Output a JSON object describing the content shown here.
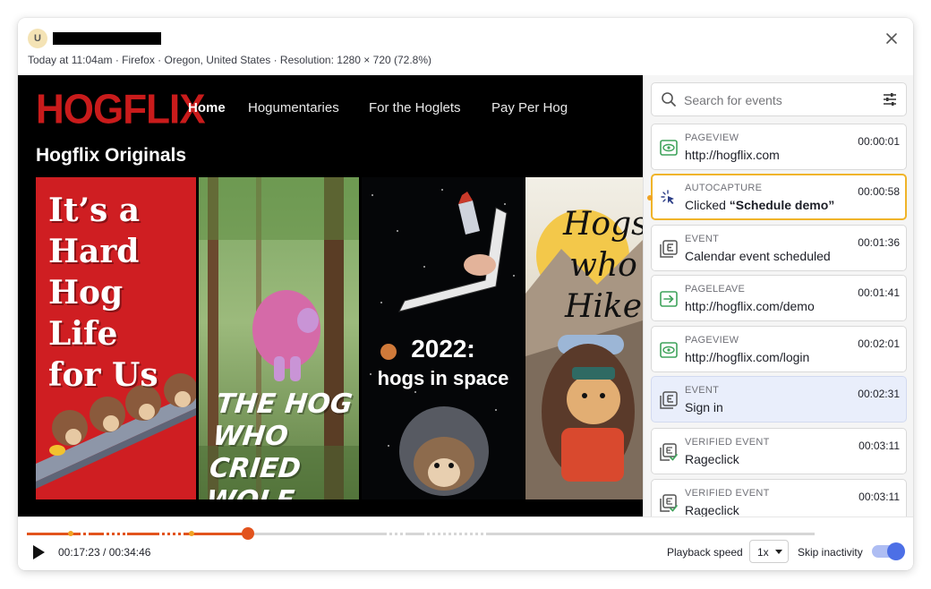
{
  "header": {
    "avatar_initial": "U",
    "meta": "Today at 11:04am · Firefox · Oregon, United States · Resolution: 1280 × 720 (72.8%)"
  },
  "video": {
    "logo": "HOGFLIX",
    "nav": [
      {
        "label": "Home",
        "active": true
      },
      {
        "label": "Hogumentaries",
        "active": false
      },
      {
        "label": "For the Hoglets",
        "active": false
      },
      {
        "label": "Pay Per Hog",
        "active": false
      }
    ],
    "section_title": "Hogflix Originals",
    "posters": [
      {
        "title": "It’s a\nHard\nHog Life\nfor Us"
      },
      {
        "title": "THE HOG\nWHO CRIED\nWOLF"
      },
      {
        "title_line1": "2022:",
        "title_line2": "hogs in space"
      },
      {
        "title": "Hogs\nwho\nHike"
      }
    ]
  },
  "sidebar": {
    "search_placeholder": "Search for events",
    "events": [
      {
        "type": "PAGEVIEW",
        "label": "http://hogflix.com",
        "time": "00:00:01",
        "icon": "eye-icon"
      },
      {
        "type": "AUTOCAPTURE",
        "label_prefix": "Clicked ",
        "label_strong": "“Schedule demo”",
        "time": "00:00:58",
        "icon": "cursor-click-icon"
      },
      {
        "type": "EVENT",
        "label": "Calendar event scheduled",
        "time": "00:01:36",
        "icon": "event-icon"
      },
      {
        "type": "PAGELEAVE",
        "label": "http://hogflix.com/demo",
        "time": "00:01:41",
        "icon": "page-leave-icon"
      },
      {
        "type": "PAGEVIEW",
        "label": "http://hogflix.com/login",
        "time": "00:02:01",
        "icon": "eye-icon"
      },
      {
        "type": "EVENT",
        "label": "Sign in",
        "time": "00:02:31",
        "icon": "event-icon"
      },
      {
        "type": "VERIFIED EVENT",
        "label": "Rageclick",
        "time": "00:03:11",
        "icon": "verified-event-icon"
      },
      {
        "type": "VERIFIED EVENT",
        "label": "Rageclick",
        "time": "00:03:11",
        "icon": "verified-event-icon"
      }
    ]
  },
  "playback": {
    "current_time": "00:17:23",
    "separator": " / ",
    "total_time": "00:34:46",
    "progress_fraction": 0.28,
    "speed_label": "Playback speed",
    "speed_value": "1x",
    "skip_label": "Skip inactivity",
    "skip_enabled": true
  },
  "colors": {
    "accent": "#e2531d",
    "focus_border": "#f0b429",
    "event_icon_green": "#3fa35b",
    "toggle": "#4c6fe6",
    "hogflix_red": "#c91b1b"
  }
}
